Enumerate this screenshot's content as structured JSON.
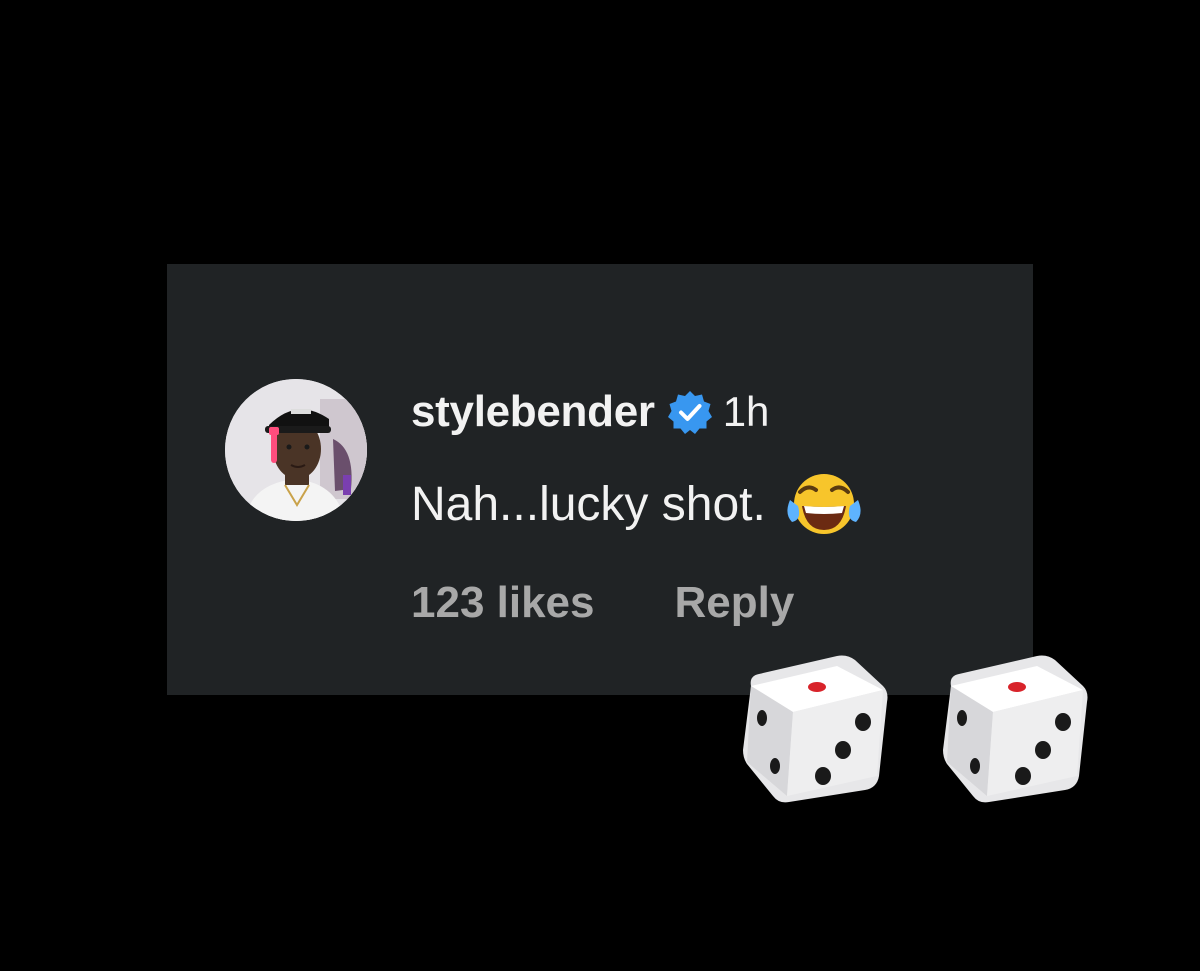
{
  "comment": {
    "username": "stylebender",
    "verified": true,
    "timestamp": "1h",
    "text": "Nah...lucky shot.",
    "emoji": "face-with-tears-of-joy",
    "likes": "123 likes",
    "reply_label": "Reply"
  },
  "decorations": {
    "dice": [
      "game-die",
      "game-die"
    ]
  },
  "colors": {
    "background": "#000000",
    "card": "#202325",
    "text": "#f2f2f2",
    "muted": "#a8a8a8",
    "verified_badge": "#3897f0",
    "die_pip_red": "#d8232a"
  }
}
